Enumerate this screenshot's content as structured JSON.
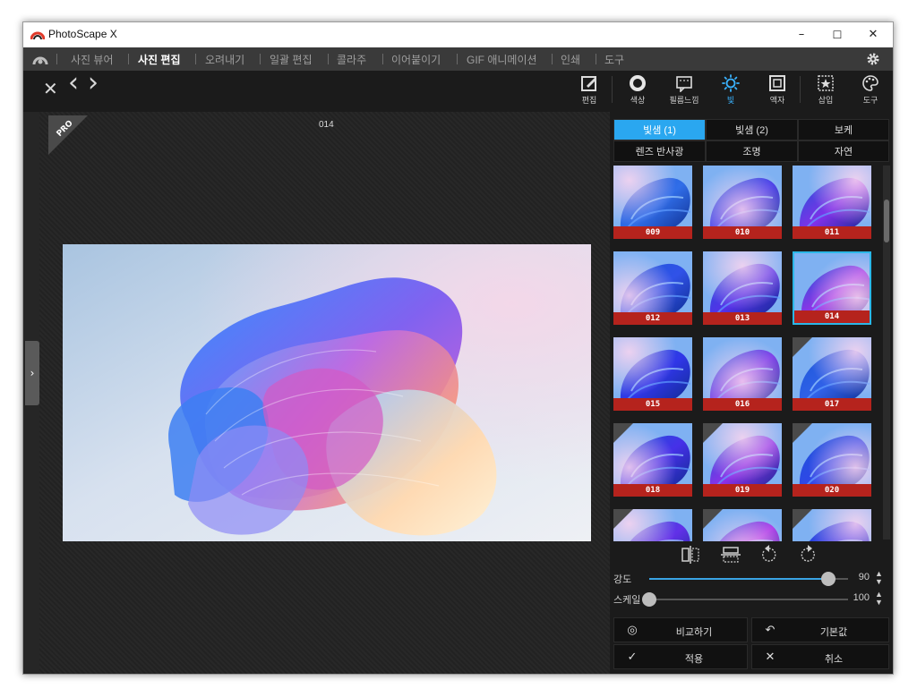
{
  "window": {
    "title": "PhotoScape X",
    "controls": {
      "minimize": "–",
      "maximize": "☐",
      "close": "✕"
    }
  },
  "menu": {
    "items": [
      "사진 뷰어",
      "사진 편집",
      "오려내기",
      "일괄 편집",
      "콜라주",
      "이어붙이기",
      "GIF 애니메이션",
      "인쇄",
      "도구"
    ],
    "active": "사진 편집"
  },
  "nav": {
    "close": "✕",
    "prev": "‹",
    "next": "›"
  },
  "tools": [
    {
      "label": "편집",
      "icon": "pencil-box-icon"
    },
    {
      "label": "색상",
      "icon": "circle-icon"
    },
    {
      "label": "필름느낌",
      "icon": "film-icon"
    },
    {
      "label": "빛",
      "icon": "sun-icon",
      "active": true
    },
    {
      "label": "액자",
      "icon": "frame-icon"
    },
    {
      "label": "삽입",
      "icon": "star-box-icon"
    },
    {
      "label": "도구",
      "icon": "palette-icon"
    }
  ],
  "canvas": {
    "image_number": "014",
    "pro_badge": "PRO"
  },
  "tabs": {
    "row1": [
      "빛샘 (1)",
      "빛샘 (2)",
      "보케"
    ],
    "row2": [
      "렌즈 반사광",
      "조명",
      "자연"
    ],
    "selected": "빛샘 (1)"
  },
  "thumbnails": [
    {
      "label": "009",
      "pro": false
    },
    {
      "label": "010",
      "pro": false
    },
    {
      "label": "011",
      "pro": false
    },
    {
      "label": "012",
      "pro": false
    },
    {
      "label": "013",
      "pro": false
    },
    {
      "label": "014",
      "pro": false,
      "selected": true
    },
    {
      "label": "015",
      "pro": false
    },
    {
      "label": "016",
      "pro": false
    },
    {
      "label": "017",
      "pro": true
    },
    {
      "label": "018",
      "pro": true
    },
    {
      "label": "019",
      "pro": true
    },
    {
      "label": "020",
      "pro": true
    },
    {
      "label": "",
      "pro": true
    },
    {
      "label": "",
      "pro": true
    },
    {
      "label": "",
      "pro": true
    }
  ],
  "transform_icons": [
    "flip-horizontal-icon",
    "flip-vertical-icon",
    "rotate-left-icon",
    "rotate-right-icon"
  ],
  "sliders": {
    "strength": {
      "label": "강도",
      "value": "90",
      "fraction": 0.9
    },
    "scale": {
      "label": "스케일",
      "value": "100",
      "fraction": 0.0
    }
  },
  "buttons": {
    "compare": "비교하기",
    "default": "기본값",
    "apply": "적용",
    "cancel": "취소"
  },
  "colors": {
    "accent": "#2aa7f0",
    "label_red": "#b5231d",
    "selection": "#2bb7e8"
  }
}
